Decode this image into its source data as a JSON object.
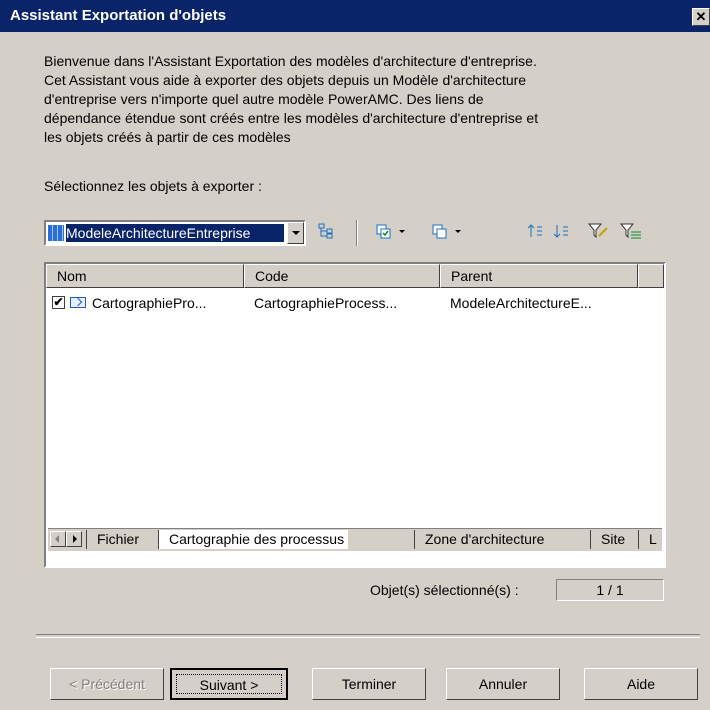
{
  "window": {
    "title": "Assistant Exportation d'objets",
    "close_label": "✕"
  },
  "intro_lines": [
    "Bienvenue dans l'Assistant Exportation des modèles d'architecture d'entreprise.",
    "Cet Assistant vous aide à exporter des objets depuis un Modèle d'architecture",
    "d'entreprise vers n'importe quel autre modèle PowerAMC. Des liens de",
    "dépendance étendue sont créés entre les modèles d'architecture d'entreprise et",
    "les objets créés à partir de ces modèles"
  ],
  "select_label": "Sélectionnez les objets à exporter :",
  "toolbar": {
    "model_combo_value": "ModeleArchitectureEntreprise",
    "icons": [
      "hierarchy-icon",
      "select-all-icon",
      "deselect-all-icon",
      "move-up-icon",
      "move-down-icon",
      "filter-icon",
      "clear-filter-icon"
    ]
  },
  "list": {
    "columns": [
      "Nom",
      "Code",
      "Parent"
    ],
    "rows": [
      {
        "checked": true,
        "name": "CartographiePro...",
        "code": "CartographieProcess...",
        "parent": "ModeleArchitectureE..."
      }
    ]
  },
  "tabs": [
    "Fichier",
    "Cartographie des processus",
    "Zone d'architecture",
    "Site",
    "L"
  ],
  "active_tab": 1,
  "selection": {
    "label": "Objet(s) sélectionné(s) :",
    "count": "1 / 1"
  },
  "buttons": {
    "previous": "< Précédent",
    "next": "Suivant >",
    "finish": "Terminer",
    "cancel": "Annuler",
    "help": "Aide"
  }
}
